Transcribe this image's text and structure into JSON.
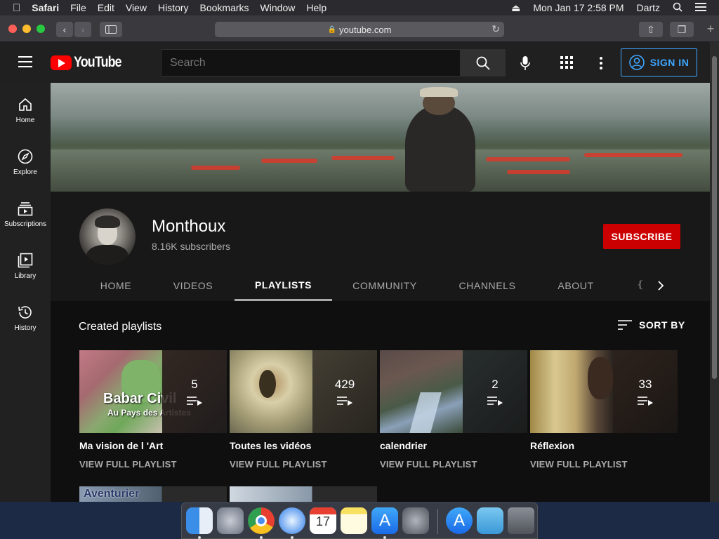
{
  "menubar": {
    "app": "Safari",
    "items": [
      "File",
      "Edit",
      "View",
      "History",
      "Bookmarks",
      "Window",
      "Help"
    ],
    "datetime": "Mon Jan 17  2:58 PM",
    "user": "Dartz"
  },
  "browser": {
    "url": "youtube.com"
  },
  "youtube": {
    "logo_text": "YouTube",
    "search_placeholder": "Search",
    "sign_in": "SIGN IN",
    "sidebar": [
      {
        "label": "Home",
        "icon": "home-icon"
      },
      {
        "label": "Explore",
        "icon": "compass-icon"
      },
      {
        "label": "Subscriptions",
        "icon": "subscriptions-icon"
      },
      {
        "label": "Library",
        "icon": "library-icon"
      },
      {
        "label": "History",
        "icon": "history-icon"
      }
    ],
    "channel": {
      "name": "Monthoux",
      "subscribers": "8.16K subscribers",
      "subscribe_label": "SUBSCRIBE"
    },
    "tabs": [
      "HOME",
      "VIDEOS",
      "PLAYLISTS",
      "COMMUNITY",
      "CHANNELS",
      "ABOUT"
    ],
    "active_tab": "PLAYLISTS",
    "section_title": "Created playlists",
    "sort_by": "SORT BY",
    "playlists": [
      {
        "title": "Ma vision de l 'Art",
        "count": "5",
        "link": "VIEW FULL PLAYLIST",
        "thumb_text": "Babar Civil",
        "thumb_subtext": "Au Pays des Artistes"
      },
      {
        "title": "Toutes les vidéos",
        "count": "429",
        "link": "VIEW FULL PLAYLIST"
      },
      {
        "title": "calendrier",
        "count": "2",
        "link": "VIEW FULL PLAYLIST"
      },
      {
        "title": "Réflexion",
        "count": "33",
        "link": "VIEW FULL PLAYLIST"
      }
    ],
    "row2_thumb_text": "Aventurier"
  },
  "colors": {
    "accent_red": "#cc0000",
    "link_blue": "#3ea6ff",
    "bg": "#0f0f0f"
  }
}
